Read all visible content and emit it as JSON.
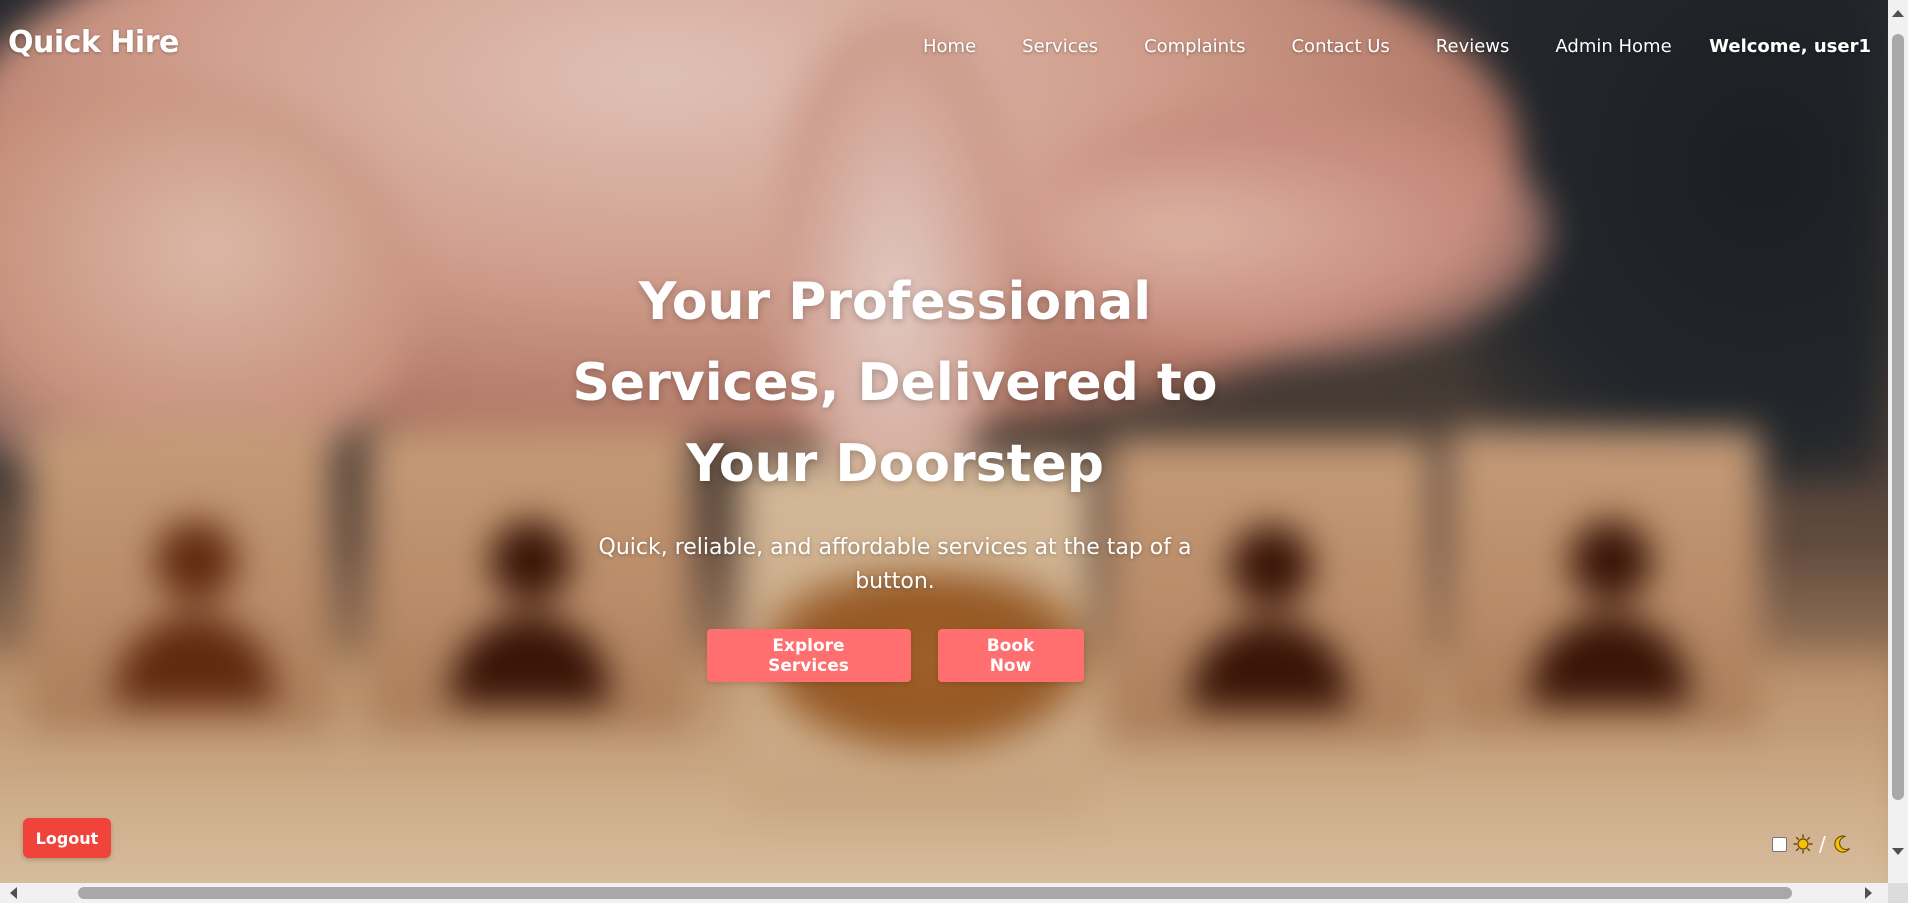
{
  "navbar": {
    "logo": "Quick Hire",
    "links": [
      {
        "label": "Home"
      },
      {
        "label": "Services"
      },
      {
        "label": "Complaints"
      },
      {
        "label": "Contact Us"
      },
      {
        "label": "Reviews"
      },
      {
        "label": "Admin Home"
      }
    ],
    "welcome": "Welcome, user1"
  },
  "hero": {
    "title": "Your Professional Services, Delivered to Your Doorstep",
    "subtitle": "Quick, reliable, and affordable services at the tap of a button.",
    "buttons": {
      "explore": "Explore Services",
      "book": "Book Now"
    }
  },
  "logout": {
    "label": "Logout"
  },
  "theme_toggle": {
    "light_icon": "sun-icon",
    "separator": "/",
    "dark_icon": "moon-icon",
    "checked": false
  },
  "colors": {
    "button_primary": "#ff6f6f",
    "logout": "#f0433a",
    "text_on_hero": "#ffffff",
    "icon_yellow": "#e3b400"
  }
}
